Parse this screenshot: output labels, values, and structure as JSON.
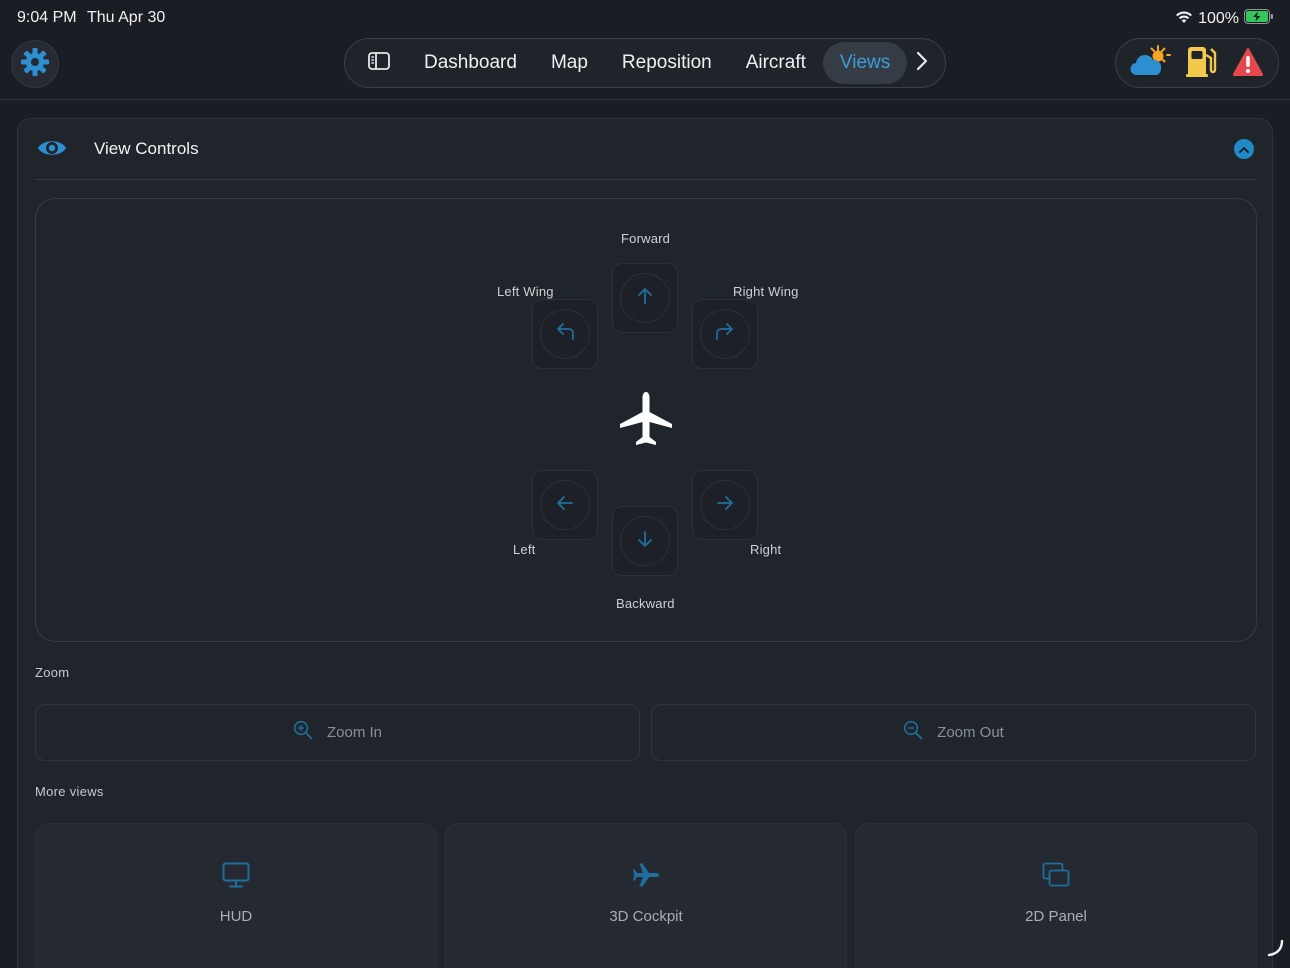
{
  "status_bar": {
    "time": "9:04 PM",
    "date": "Thu Apr 30",
    "battery": "100%",
    "icons": [
      "wifi-icon",
      "battery-charging-icon"
    ]
  },
  "nav": {
    "tabs": [
      {
        "label": "Dashboard",
        "active": false
      },
      {
        "label": "Map",
        "active": false
      },
      {
        "label": "Reposition",
        "active": false
      },
      {
        "label": "Aircraft",
        "active": false
      },
      {
        "label": "Views",
        "active": true
      }
    ],
    "icons": [
      "gear-icon",
      "sidebar-toggle-icon",
      "chevron-right-icon"
    ]
  },
  "quick_actions": {
    "icons": [
      "weather-icon",
      "fuel-icon",
      "warning-icon"
    ]
  },
  "view_controls": {
    "title": "View Controls",
    "icons": [
      "eye-icon",
      "chevron-up-icon"
    ],
    "directions": {
      "forward": "Forward",
      "left_wing": "Left Wing",
      "right_wing": "Right Wing",
      "left": "Left",
      "right": "Right",
      "backward": "Backward"
    },
    "center_icon": "airplane-icon"
  },
  "zoom": {
    "section_label": "Zoom",
    "zoom_in": "Zoom In",
    "zoom_out": "Zoom Out"
  },
  "more_views": {
    "section_label": "More views",
    "items": [
      {
        "label": "HUD",
        "icon": "monitor-icon"
      },
      {
        "label": "3D Cockpit",
        "icon": "airplane-icon"
      },
      {
        "label": "2D Panel",
        "icon": "panels-icon"
      }
    ]
  },
  "colors": {
    "accent": "#3b9fd6",
    "background": "#1a1d23",
    "panel": "#20252c",
    "warning": "#e5484d",
    "fuel": "#f2c94c"
  }
}
